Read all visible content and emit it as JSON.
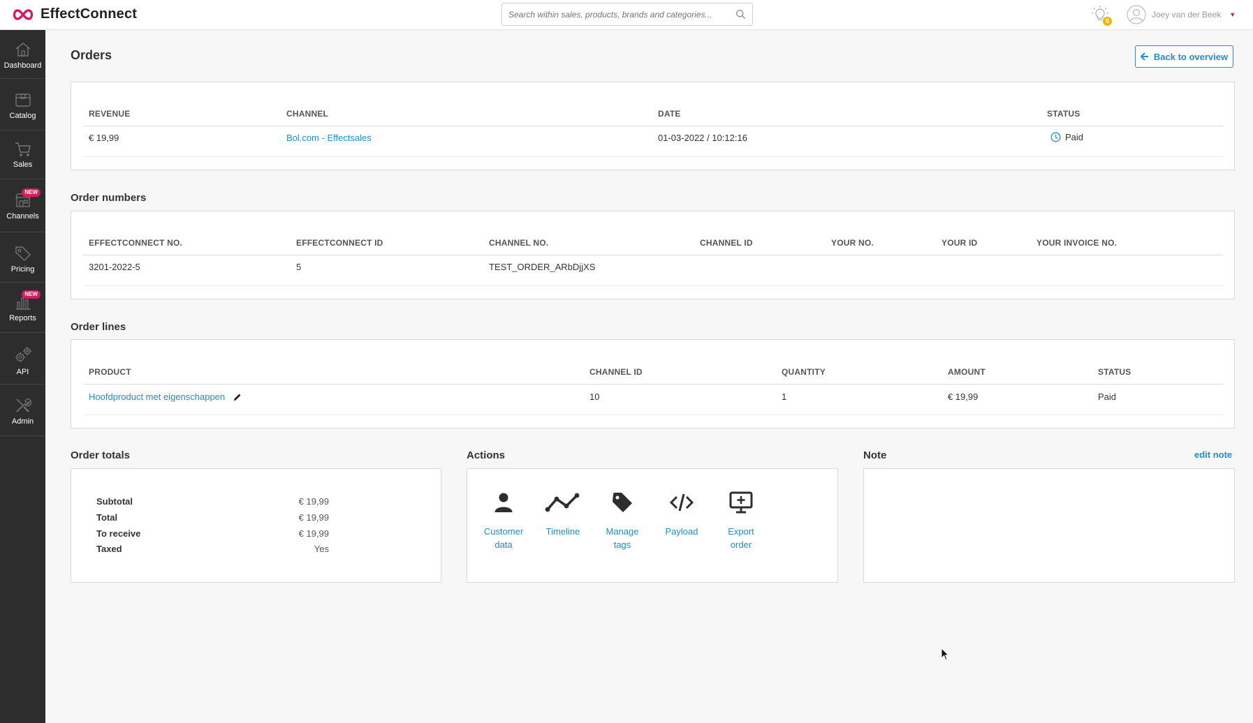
{
  "app": {
    "brand": "EffectConnect"
  },
  "search": {
    "placeholder": "Search within sales, products, brands and categories..."
  },
  "header": {
    "notification_count": "0",
    "user_name": "Joey van der Beek"
  },
  "sidebar": {
    "items": [
      {
        "label": "Dashboard",
        "icon": "home-icon"
      },
      {
        "label": "Catalog",
        "icon": "box-icon"
      },
      {
        "label": "Sales",
        "icon": "cart-icon"
      },
      {
        "label": "Channels",
        "icon": "store-icon",
        "badge": "NEW"
      },
      {
        "label": "Pricing",
        "icon": "tag-icon"
      },
      {
        "label": "Reports",
        "icon": "bar-chart-icon",
        "badge": "NEW"
      },
      {
        "label": "API",
        "icon": "gears-icon"
      },
      {
        "label": "Admin",
        "icon": "tools-icon"
      }
    ]
  },
  "page": {
    "title": "Orders",
    "back_label": "Back to overview"
  },
  "summary": {
    "headers": [
      "REVENUE",
      "CHANNEL",
      "DATE",
      "STATUS"
    ],
    "row": {
      "revenue": "€ 19,99",
      "channel": "Bol.com - Effectsales",
      "date": "01-03-2022 / 10:12:16",
      "status": "Paid"
    }
  },
  "order_numbers": {
    "title": "Order numbers",
    "headers": [
      "EFFECTCONNECT NO.",
      "EFFECTCONNECT ID",
      "CHANNEL NO.",
      "CHANNEL ID",
      "YOUR NO.",
      "YOUR ID",
      "YOUR INVOICE NO."
    ],
    "row": [
      "3201-2022-5",
      "5",
      "TEST_ORDER_ARbDjjXS",
      "",
      "",
      "",
      ""
    ]
  },
  "order_lines": {
    "title": "Order lines",
    "headers": [
      "PRODUCT",
      "CHANNEL ID",
      "QUANTITY",
      "AMOUNT",
      "STATUS"
    ],
    "rows": [
      {
        "product": "Hoofdproduct met eigenschappen",
        "channel_id": "10",
        "quantity": "1",
        "amount": "€ 19,99",
        "status": "Paid"
      }
    ]
  },
  "order_totals": {
    "title": "Order totals",
    "rows": [
      {
        "label": "Subtotal",
        "value": "€ 19,99"
      },
      {
        "label": "Total",
        "value": "€ 19,99"
      },
      {
        "label": "To receive",
        "value": "€ 19,99"
      },
      {
        "label": "Taxed",
        "value": "Yes"
      }
    ]
  },
  "actions": {
    "title": "Actions",
    "items": [
      {
        "label_line1": "Customer",
        "label_line2": "data",
        "icon": "user-icon"
      },
      {
        "label_line1": "Timeline",
        "label_line2": "",
        "icon": "timeline-icon"
      },
      {
        "label_line1": "Manage",
        "label_line2": "tags",
        "icon": "tag-icon"
      },
      {
        "label_line1": "Payload",
        "label_line2": "",
        "icon": "code-icon"
      },
      {
        "label_line1": "Export",
        "label_line2": "order",
        "icon": "export-icon"
      }
    ]
  },
  "note": {
    "title": "Note",
    "edit_label": "edit note",
    "content": ""
  },
  "colors": {
    "accent": "#1c8fcf",
    "sidebar_bg": "#2d2d2d",
    "badge_new": "#d81b60",
    "notification": "#f2b600"
  }
}
